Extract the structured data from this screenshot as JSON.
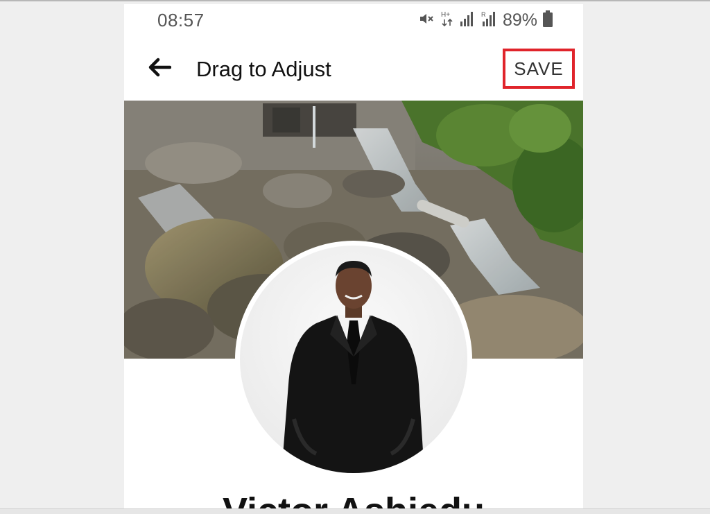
{
  "status_bar": {
    "time": "08:57",
    "battery_percent": "89%",
    "icons": [
      "mute-icon",
      "hplus-network-icon",
      "signal-icon",
      "roaming-signal-icon",
      "battery-icon"
    ]
  },
  "app_bar": {
    "back_icon": "arrow-left-icon",
    "title": "Drag to Adjust",
    "save_label": "SAVE"
  },
  "cover_photo": {
    "description_icon": "cover-photo"
  },
  "profile": {
    "avatar_icon": "profile-photo",
    "name": "Victor Ashiedu"
  },
  "colors": {
    "highlight": "#e0242b",
    "title_text": "#111111",
    "status_text": "#555555"
  }
}
